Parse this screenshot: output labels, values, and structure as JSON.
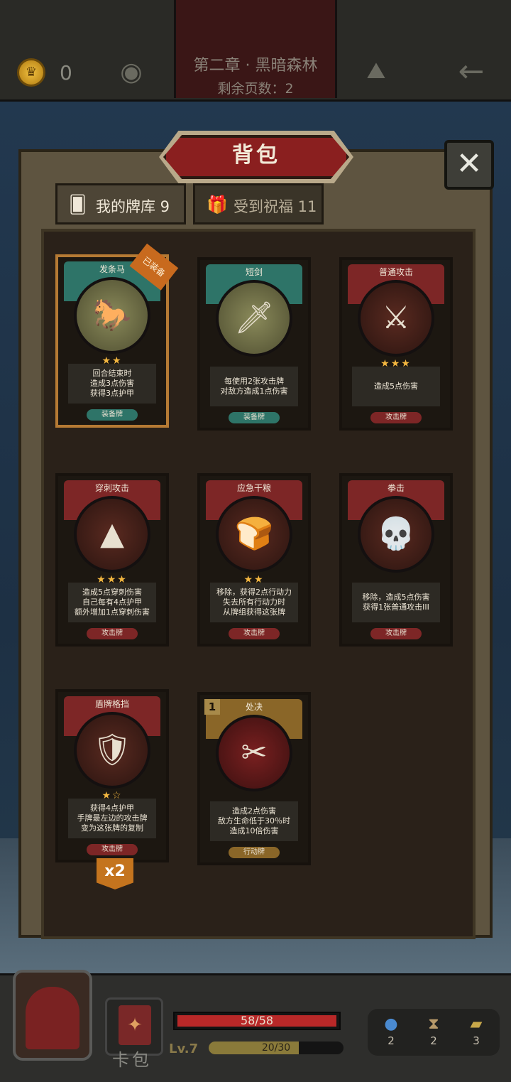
{
  "topbar": {
    "coins": "0",
    "chapter": "第二章 · 黑暗森林",
    "pages_left": "剩余页数：2"
  },
  "panel": {
    "title": "背包",
    "close_icon": "✕",
    "tabs": [
      {
        "label": "我的牌库 9",
        "icon": "cards-icon"
      },
      {
        "label": "受到祝福 11",
        "icon": "gift-icon"
      }
    ]
  },
  "cards": [
    {
      "name": "发条马",
      "desc": "回合结束时\n造成3点伤害\n获得3点护甲",
      "type": "装备牌",
      "stars": "★★",
      "badge": "已装备",
      "color": "teal"
    },
    {
      "name": "短剑",
      "desc": "每使用2张攻击牌\n对敌方造成1点伤害",
      "type": "装备牌",
      "stars": "",
      "color": "teal"
    },
    {
      "name": "普通攻击",
      "desc": "造成5点伤害",
      "type": "攻击牌",
      "stars": "★★★",
      "color": "red"
    },
    {
      "name": "穿刺攻击",
      "desc": "造成5点穿刺伤害\n自己每有4点护甲\n额外增加1点穿刺伤害",
      "type": "攻击牌",
      "stars": "★★★",
      "color": "red"
    },
    {
      "name": "应急干粮",
      "desc": "移除，获得2点行动力\n失去所有行动力时\n从牌组获得这张牌",
      "type": "攻击牌",
      "stars": "★★",
      "color": "red"
    },
    {
      "name": "拳击",
      "desc": "移除，造成5点伤害\n获得1张普通攻击III",
      "type": "攻击牌",
      "stars": "",
      "color": "red"
    },
    {
      "name": "盾牌格挡",
      "desc": "获得4点护甲\n手牌最左边的攻击牌\n变为这张牌的复制",
      "type": "攻击牌",
      "stars": "★☆",
      "copies": "x2",
      "color": "red"
    },
    {
      "name": "处决",
      "desc": "造成2点伤害\n敌方生命低于30％时\n造成10倍伤害",
      "type": "行动牌",
      "stars": "",
      "cost": "1",
      "color": "gold"
    }
  ],
  "bottombar": {
    "cardpack_label": "卡包",
    "hp": "58/58",
    "hp_fraction": 1.0,
    "level": "Lv.7",
    "xp": "20/30",
    "xp_fraction": 0.667,
    "stats": [
      {
        "icon": "potion-icon",
        "value": "2"
      },
      {
        "icon": "hourglass-icon",
        "value": "2"
      },
      {
        "icon": "cards-stack-icon",
        "value": "3"
      }
    ]
  }
}
